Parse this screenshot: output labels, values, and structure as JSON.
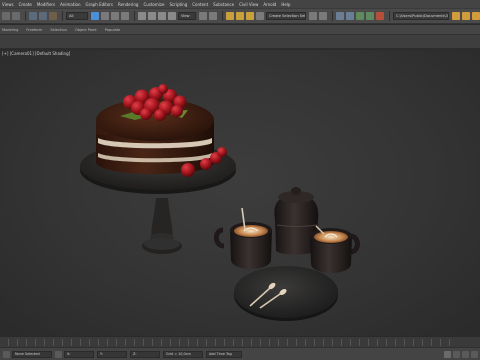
{
  "menubar": {
    "items": [
      "Views",
      "Create",
      "Modifiers",
      "Animation",
      "Graph Editors",
      "Rendering",
      "Customize",
      "Scripting",
      "Content",
      "Substance",
      "Civil View",
      "Arnold",
      "Help"
    ]
  },
  "toolbar": {
    "view_dropdown": "View",
    "selection_set": "Create Selection Set",
    "project_path": "C:\\Users\\Public\\Documents\\3ds Max"
  },
  "ribbon": {
    "tabs": [
      "Modeling",
      "Freeform",
      "Selection",
      "Object Paint",
      "Populate"
    ]
  },
  "viewport": {
    "label": "[+] [Camera01] [Default Shading]"
  },
  "statusbar": {
    "selection": "None Selected",
    "x": "X:",
    "y": "Y:",
    "z": "Z:",
    "grid": "Grid = 10,0cm",
    "add_time_tag": "Add Time Tag"
  },
  "colors": {
    "chocolate": "#3a1d12",
    "cream": "#e8dcc8",
    "strawberry": "#a3141c",
    "stand": "#2c2b2a",
    "ceramic": "#2a2422"
  }
}
